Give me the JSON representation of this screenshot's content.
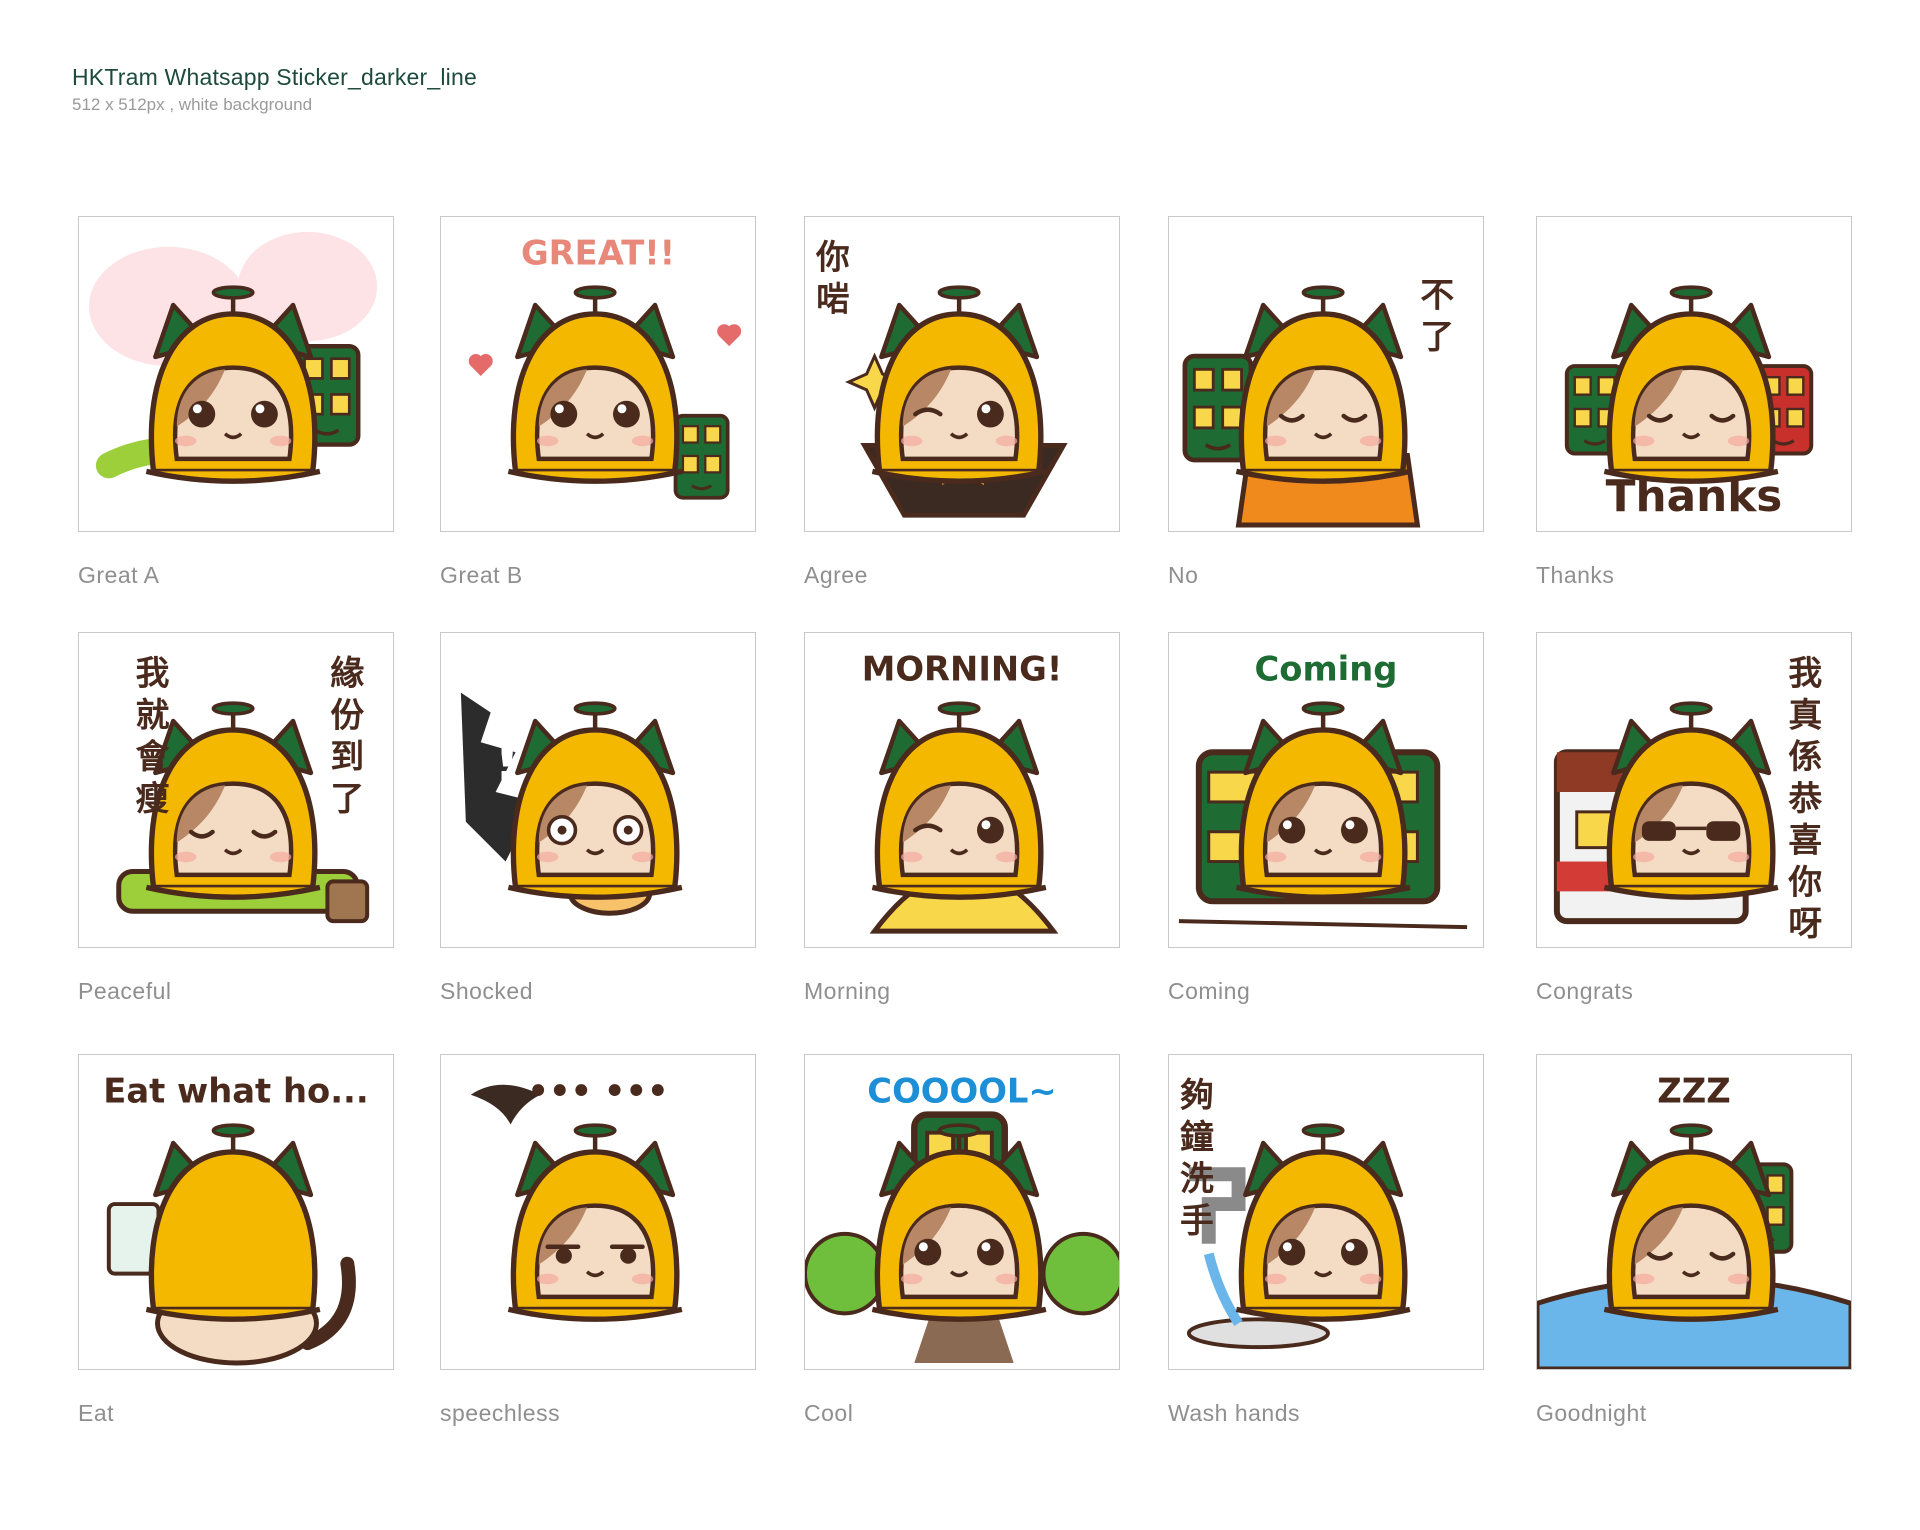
{
  "header": {
    "title": "HKTram Whatsapp Sticker_darker_line",
    "subtitle": "512 x 512px , white background"
  },
  "stickers": [
    {
      "label": "Great A",
      "caption": "",
      "scene": "scarf-tram",
      "mood": "happy"
    },
    {
      "label": "Great B",
      "caption": "GREAT!!",
      "scene": "hearts",
      "mood": "sparkle"
    },
    {
      "label": "Agree",
      "caption": "你啱",
      "scene": "wine",
      "mood": "wink"
    },
    {
      "label": "No",
      "caption": "不了",
      "scene": "jacket",
      "mood": "calm"
    },
    {
      "label": "Thanks",
      "caption": "Thanks",
      "scene": "two-trams",
      "mood": "calm"
    },
    {
      "label": "Peaceful",
      "caption": "緣份到了 我就會瘦",
      "scene": "cushion",
      "mood": "calm"
    },
    {
      "label": "Shocked",
      "caption": "!",
      "scene": "eggtart",
      "mood": "shock"
    },
    {
      "label": "Morning",
      "caption": "MORNING!",
      "scene": "bell",
      "mood": "wink"
    },
    {
      "label": "Coming",
      "caption": "Coming",
      "scene": "big-tram",
      "mood": "happy"
    },
    {
      "label": "Congrats",
      "caption": "我真係恭喜你呀",
      "scene": "red-tram",
      "mood": "cool"
    },
    {
      "label": "Eat",
      "caption": "Eat what ho...",
      "scene": "back",
      "mood": "none"
    },
    {
      "label": "speechless",
      "caption": "••• •••",
      "scene": "crow",
      "mood": "bored"
    },
    {
      "label": "Cool",
      "caption": "COOOOL~",
      "scene": "road-tram",
      "mood": "happy"
    },
    {
      "label": "Wash hands",
      "caption": "夠鐘洗手",
      "scene": "tap",
      "mood": "happy"
    },
    {
      "label": "Goodnight",
      "caption": "ZZZ",
      "scene": "bed",
      "mood": "sleep"
    }
  ],
  "colors": {
    "helmet": "#f5b800",
    "green": "#1e6b34",
    "outline": "#4a2a1c",
    "fur": "#f4dcc4",
    "patch": "#b88866"
  }
}
